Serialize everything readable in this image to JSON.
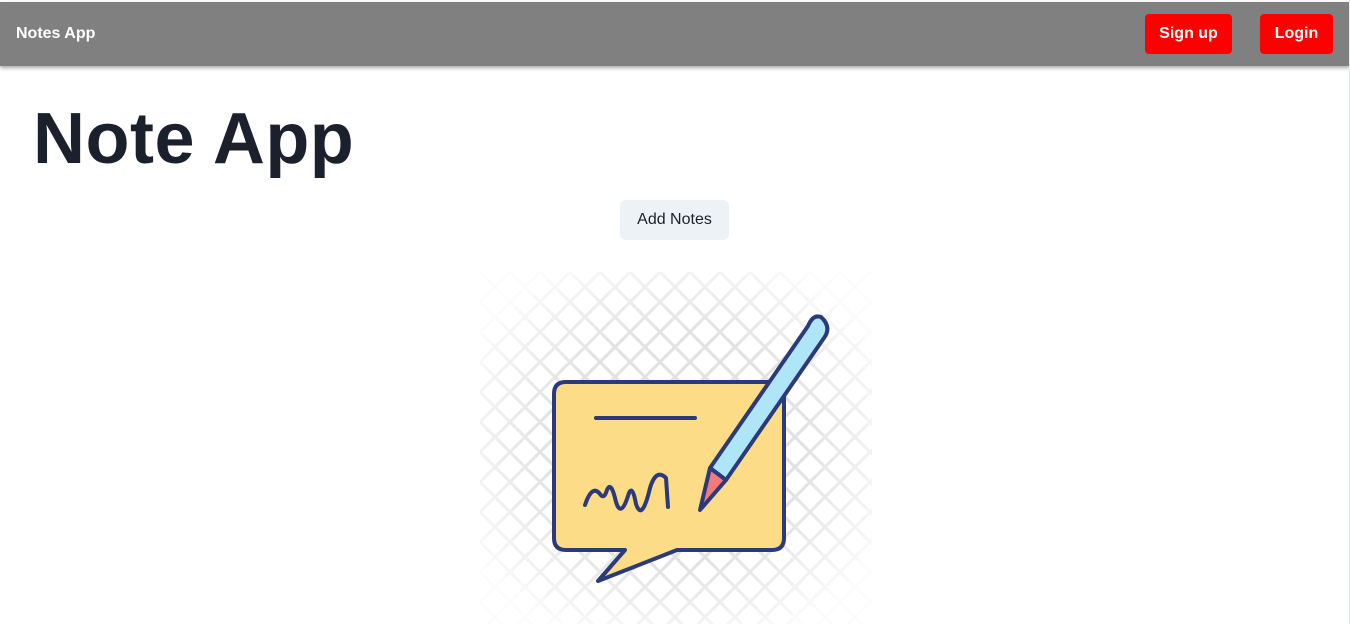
{
  "navbar": {
    "brand": "Notes App",
    "signup_label": "Sign up",
    "login_label": "Login",
    "background": "#808080",
    "button_color": "#ff0000"
  },
  "main": {
    "title": "Note App",
    "add_notes_label": "Add Notes"
  },
  "illustration": {
    "icon": "signed-note-with-pencil-icon",
    "note_color": "#fddc88",
    "pencil_color": "#aee6f8",
    "tip_color": "#f37a7a",
    "outline_color": "#2b3a7a"
  }
}
